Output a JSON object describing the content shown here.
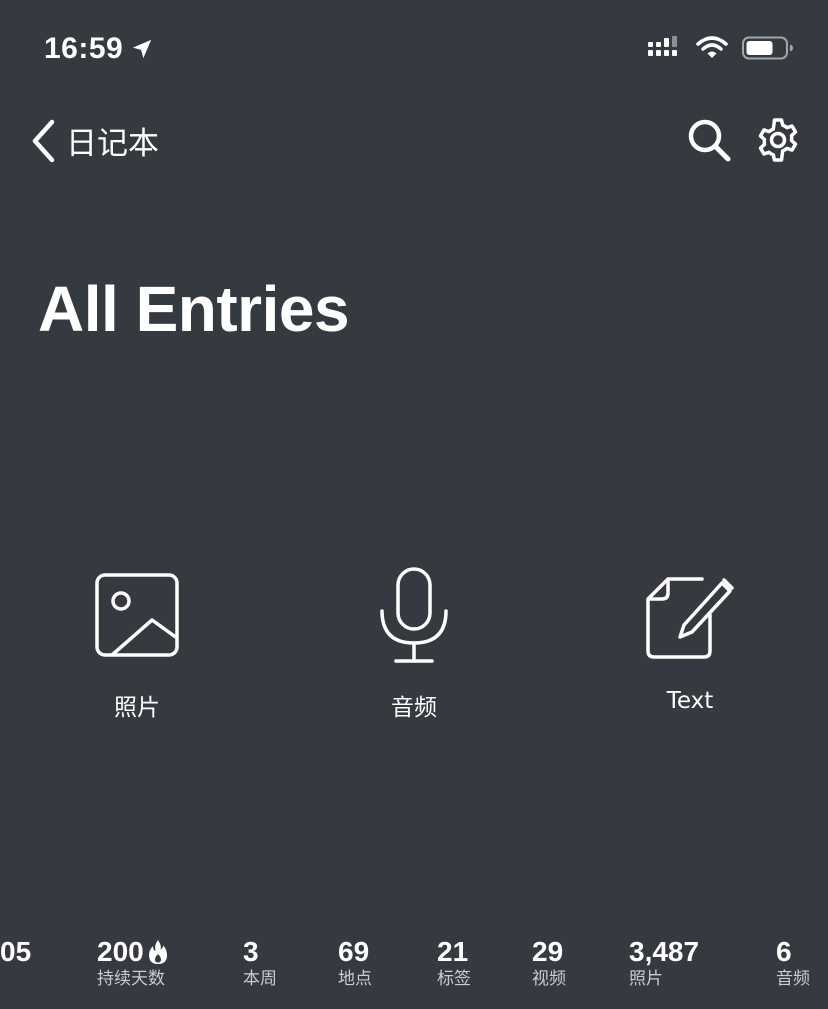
{
  "status_bar": {
    "time": "16:59",
    "icons": [
      "location-arrow-icon",
      "signal-bars-icon",
      "wifi-icon",
      "battery-icon"
    ]
  },
  "nav": {
    "back_label": "日记本",
    "icons": [
      "chevron-left-icon",
      "search-icon",
      "gear-icon"
    ]
  },
  "title": "All Entries",
  "actions": [
    {
      "label": "照片",
      "icon": "photo-icon"
    },
    {
      "label": "音频",
      "icon": "microphone-icon"
    },
    {
      "label": "Text",
      "icon": "note-edit-icon"
    }
  ],
  "stats": [
    {
      "value": "05",
      "label": ""
    },
    {
      "value": "200",
      "label": "持续天数",
      "icon": "flame-icon"
    },
    {
      "value": "3",
      "label": "本周"
    },
    {
      "value": "69",
      "label": "地点"
    },
    {
      "value": "21",
      "label": "标签"
    },
    {
      "value": "29",
      "label": "视频"
    },
    {
      "value": "3,487",
      "label": "照片"
    },
    {
      "value": "6",
      "label": "音频"
    }
  ],
  "colors": {
    "background": "#353a40",
    "foreground": "#ffffff",
    "secondary_text": "#c9ccd0"
  }
}
